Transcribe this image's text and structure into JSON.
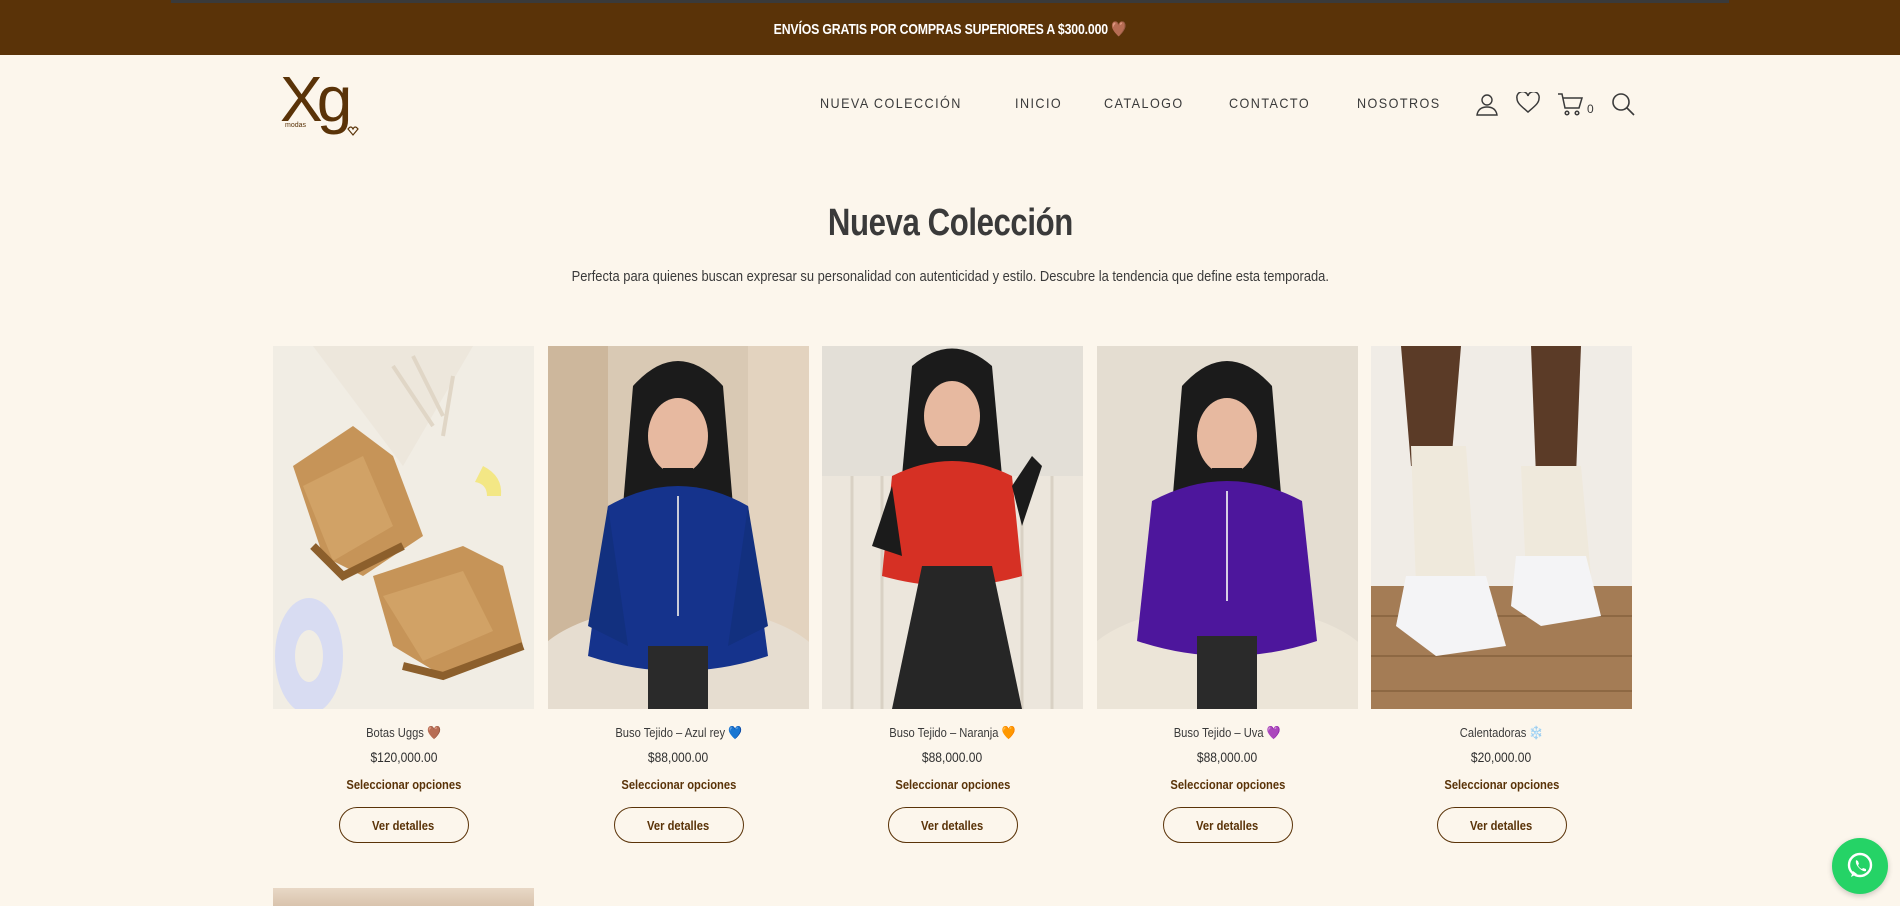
{
  "topbar": {
    "text": "ENVÍOS GRATIS POR COMPRAS SUPERIORES A $300.000 🤎"
  },
  "logo": {
    "letters": "Xg",
    "tagline": "modas"
  },
  "nav": {
    "items": [
      {
        "label": "NUEVA COLECCIÓN"
      },
      {
        "label": "INICIO"
      },
      {
        "label": "CATALOGO"
      },
      {
        "label": "CONTACTO"
      },
      {
        "label": "NOSOTROS"
      }
    ]
  },
  "header_icons": {
    "account": "user-icon",
    "wishlist": "heart-icon",
    "cart": "cart-icon",
    "cart_count": "0",
    "search": "search-icon"
  },
  "hero": {
    "title": "Nueva Colección",
    "subtitle": "Perfecta para quienes buscan expresar su personalidad con autenticidad y estilo. Descubre la tendencia que define esta temporada."
  },
  "products": [
    {
      "name": "Botas Uggs 🤎",
      "price": "$120,000.00",
      "options_label": "Seleccionar opciones",
      "details_label": "Ver detalles",
      "image": "boots-photo"
    },
    {
      "name": "Buso Tejido – Azul rey 💙",
      "price": "$88,000.00",
      "options_label": "Seleccionar opciones",
      "details_label": "Ver detalles",
      "image": "blue-sweater-photo",
      "color": "#0f2a7a"
    },
    {
      "name": "Buso Tejido – Naranja 🧡",
      "price": "$88,000.00",
      "options_label": "Seleccionar opciones",
      "details_label": "Ver detalles",
      "image": "orange-sweater-photo",
      "color": "#d42a1e"
    },
    {
      "name": "Buso Tejido – Uva 💜",
      "price": "$88,000.00",
      "options_label": "Seleccionar opciones",
      "details_label": "Ver detalles",
      "image": "purple-sweater-photo",
      "color": "#4a1496"
    },
    {
      "name": "Calentadoras ❄️",
      "price": "$20,000.00",
      "options_label": "Seleccionar opciones",
      "details_label": "Ver detalles",
      "image": "leg-warmers-photo"
    }
  ],
  "floating": {
    "icon": "whatsapp-icon"
  },
  "colors": {
    "brand": "#5a3308",
    "background": "#fcf6ec",
    "whatsapp": "#25d366"
  }
}
